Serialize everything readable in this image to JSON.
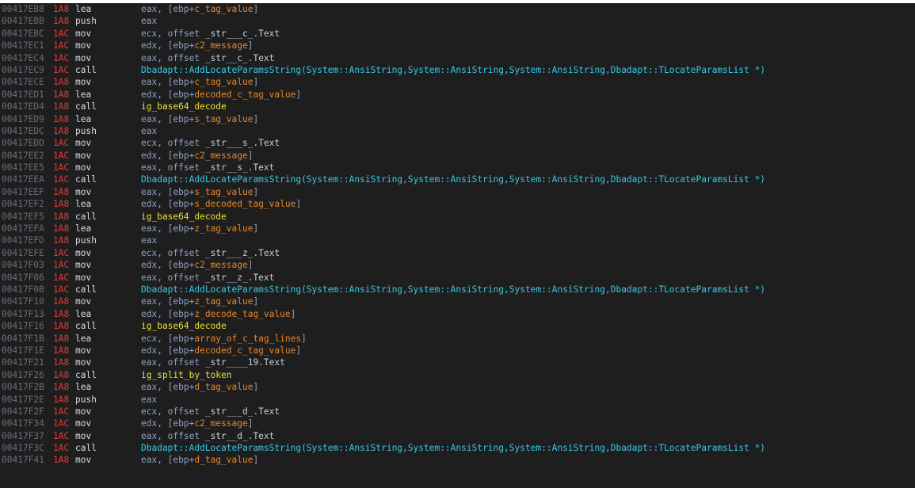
{
  "colors": {
    "background": "#1e1e1e",
    "address": "#666f7a",
    "stack_pointer": "#e23b3b",
    "mnemonic": "#d8dde6",
    "operand": "#8fa1c4",
    "symbol": "#e6862c",
    "api_call": "#38c7e8",
    "function": "#e5e134"
  },
  "lines": [
    {
      "addr": "00417EB8",
      "sp": "1A8",
      "mnem": "lea",
      "ops": [
        {
          "t": "eax, [ebp+",
          "k": "plain"
        },
        {
          "t": "c_tag_value",
          "k": "sym"
        },
        {
          "t": "]",
          "k": "plain"
        }
      ]
    },
    {
      "addr": "00417EBB",
      "sp": "1A8",
      "mnem": "push",
      "ops": [
        {
          "t": "eax",
          "k": "plain"
        }
      ]
    },
    {
      "addr": "00417EBC",
      "sp": "1AC",
      "mnem": "mov",
      "ops": [
        {
          "t": "ecx, offset ",
          "k": "plain"
        },
        {
          "t": "_str___c_.Text",
          "k": "str"
        }
      ]
    },
    {
      "addr": "00417EC1",
      "sp": "1AC",
      "mnem": "mov",
      "ops": [
        {
          "t": "edx, [ebp+",
          "k": "plain"
        },
        {
          "t": "c2_message",
          "k": "sym"
        },
        {
          "t": "]",
          "k": "plain"
        }
      ]
    },
    {
      "addr": "00417EC4",
      "sp": "1AC",
      "mnem": "mov",
      "ops": [
        {
          "t": "eax, offset ",
          "k": "plain"
        },
        {
          "t": "_str__c_.Text",
          "k": "str"
        }
      ]
    },
    {
      "addr": "00417EC9",
      "sp": "1AC",
      "mnem": "call",
      "ops": [
        {
          "t": "Dbadapt::AddLocateParamsString(System::AnsiString,System::AnsiString,System::AnsiString,Dbadapt::TLocateParamsList *)",
          "k": "api"
        }
      ]
    },
    {
      "addr": "00417ECE",
      "sp": "1A8",
      "mnem": "mov",
      "ops": [
        {
          "t": "eax, [ebp+",
          "k": "plain"
        },
        {
          "t": "c_tag_value",
          "k": "sym"
        },
        {
          "t": "]",
          "k": "plain"
        }
      ]
    },
    {
      "addr": "00417ED1",
      "sp": "1A8",
      "mnem": "lea",
      "ops": [
        {
          "t": "edx, [ebp+",
          "k": "plain"
        },
        {
          "t": "decoded_c_tag_value",
          "k": "sym"
        },
        {
          "t": "]",
          "k": "plain"
        }
      ]
    },
    {
      "addr": "00417ED4",
      "sp": "1A8",
      "mnem": "call",
      "ops": [
        {
          "t": "ig_base64_decode",
          "k": "func"
        }
      ]
    },
    {
      "addr": "00417ED9",
      "sp": "1A8",
      "mnem": "lea",
      "ops": [
        {
          "t": "eax, [ebp+",
          "k": "plain"
        },
        {
          "t": "s_tag_value",
          "k": "sym"
        },
        {
          "t": "]",
          "k": "plain"
        }
      ]
    },
    {
      "addr": "00417EDC",
      "sp": "1A8",
      "mnem": "push",
      "ops": [
        {
          "t": "eax",
          "k": "plain"
        }
      ]
    },
    {
      "addr": "00417EDD",
      "sp": "1AC",
      "mnem": "mov",
      "ops": [
        {
          "t": "ecx, offset ",
          "k": "plain"
        },
        {
          "t": "_str___s_.Text",
          "k": "str"
        }
      ]
    },
    {
      "addr": "00417EE2",
      "sp": "1AC",
      "mnem": "mov",
      "ops": [
        {
          "t": "edx, [ebp+",
          "k": "plain"
        },
        {
          "t": "c2_message",
          "k": "sym"
        },
        {
          "t": "]",
          "k": "plain"
        }
      ]
    },
    {
      "addr": "00417EE5",
      "sp": "1AC",
      "mnem": "mov",
      "ops": [
        {
          "t": "eax, offset ",
          "k": "plain"
        },
        {
          "t": "_str__s_.Text",
          "k": "str"
        }
      ]
    },
    {
      "addr": "00417EEA",
      "sp": "1AC",
      "mnem": "call",
      "ops": [
        {
          "t": "Dbadapt::AddLocateParamsString(System::AnsiString,System::AnsiString,System::AnsiString,Dbadapt::TLocateParamsList *)",
          "k": "api"
        }
      ]
    },
    {
      "addr": "00417EEF",
      "sp": "1A8",
      "mnem": "mov",
      "ops": [
        {
          "t": "eax, [ebp+",
          "k": "plain"
        },
        {
          "t": "s_tag_value",
          "k": "sym"
        },
        {
          "t": "]",
          "k": "plain"
        }
      ]
    },
    {
      "addr": "00417EF2",
      "sp": "1A8",
      "mnem": "lea",
      "ops": [
        {
          "t": "edx, [ebp+",
          "k": "plain"
        },
        {
          "t": "s_decoded_tag_value",
          "k": "sym"
        },
        {
          "t": "]",
          "k": "plain"
        }
      ]
    },
    {
      "addr": "00417EF5",
      "sp": "1A8",
      "mnem": "call",
      "ops": [
        {
          "t": "ig_base64_decode",
          "k": "func"
        }
      ]
    },
    {
      "addr": "00417EFA",
      "sp": "1A8",
      "mnem": "lea",
      "ops": [
        {
          "t": "eax, [ebp+",
          "k": "plain"
        },
        {
          "t": "z_tag_value",
          "k": "sym"
        },
        {
          "t": "]",
          "k": "plain"
        }
      ]
    },
    {
      "addr": "00417EFD",
      "sp": "1A8",
      "mnem": "push",
      "ops": [
        {
          "t": "eax",
          "k": "plain"
        }
      ]
    },
    {
      "addr": "00417EFE",
      "sp": "1AC",
      "mnem": "mov",
      "ops": [
        {
          "t": "ecx, offset ",
          "k": "plain"
        },
        {
          "t": "_str___z_.Text",
          "k": "str"
        }
      ]
    },
    {
      "addr": "00417F03",
      "sp": "1AC",
      "mnem": "mov",
      "ops": [
        {
          "t": "edx, [ebp+",
          "k": "plain"
        },
        {
          "t": "c2_message",
          "k": "sym"
        },
        {
          "t": "]",
          "k": "plain"
        }
      ]
    },
    {
      "addr": "00417F06",
      "sp": "1AC",
      "mnem": "mov",
      "ops": [
        {
          "t": "eax, offset ",
          "k": "plain"
        },
        {
          "t": "_str__z_.Text",
          "k": "str"
        }
      ]
    },
    {
      "addr": "00417F0B",
      "sp": "1AC",
      "mnem": "call",
      "ops": [
        {
          "t": "Dbadapt::AddLocateParamsString(System::AnsiString,System::AnsiString,System::AnsiString,Dbadapt::TLocateParamsList *)",
          "k": "api"
        }
      ]
    },
    {
      "addr": "00417F10",
      "sp": "1A8",
      "mnem": "mov",
      "ops": [
        {
          "t": "eax, [ebp+",
          "k": "plain"
        },
        {
          "t": "z_tag_value",
          "k": "sym"
        },
        {
          "t": "]",
          "k": "plain"
        }
      ]
    },
    {
      "addr": "00417F13",
      "sp": "1A8",
      "mnem": "lea",
      "ops": [
        {
          "t": "edx, [ebp+",
          "k": "plain"
        },
        {
          "t": "z_decode_tag_value",
          "k": "sym"
        },
        {
          "t": "]",
          "k": "plain"
        }
      ]
    },
    {
      "addr": "00417F16",
      "sp": "1A8",
      "mnem": "call",
      "ops": [
        {
          "t": "ig_base64_decode",
          "k": "func"
        }
      ]
    },
    {
      "addr": "00417F1B",
      "sp": "1A8",
      "mnem": "lea",
      "ops": [
        {
          "t": "ecx, [ebp+",
          "k": "plain"
        },
        {
          "t": "array_of_c_tag_lines",
          "k": "sym"
        },
        {
          "t": "]",
          "k": "plain"
        }
      ]
    },
    {
      "addr": "00417F1E",
      "sp": "1A8",
      "mnem": "mov",
      "ops": [
        {
          "t": "edx, [ebp+",
          "k": "plain"
        },
        {
          "t": "decoded_c_tag_value",
          "k": "sym"
        },
        {
          "t": "]",
          "k": "plain"
        }
      ]
    },
    {
      "addr": "00417F21",
      "sp": "1A8",
      "mnem": "mov",
      "ops": [
        {
          "t": "eax, offset ",
          "k": "plain"
        },
        {
          "t": "_str____19.Text",
          "k": "str"
        }
      ]
    },
    {
      "addr": "00417F26",
      "sp": "1A8",
      "mnem": "call",
      "ops": [
        {
          "t": "ig_split_by_token",
          "k": "func"
        }
      ]
    },
    {
      "addr": "00417F2B",
      "sp": "1A8",
      "mnem": "lea",
      "ops": [
        {
          "t": "eax, [ebp+",
          "k": "plain"
        },
        {
          "t": "d_tag_value",
          "k": "sym"
        },
        {
          "t": "]",
          "k": "plain"
        }
      ]
    },
    {
      "addr": "00417F2E",
      "sp": "1A8",
      "mnem": "push",
      "ops": [
        {
          "t": "eax",
          "k": "plain"
        }
      ]
    },
    {
      "addr": "00417F2F",
      "sp": "1AC",
      "mnem": "mov",
      "ops": [
        {
          "t": "ecx, offset ",
          "k": "plain"
        },
        {
          "t": "_str___d_.Text",
          "k": "str"
        }
      ]
    },
    {
      "addr": "00417F34",
      "sp": "1AC",
      "mnem": "mov",
      "ops": [
        {
          "t": "edx, [ebp+",
          "k": "plain"
        },
        {
          "t": "c2_message",
          "k": "sym"
        },
        {
          "t": "]",
          "k": "plain"
        }
      ]
    },
    {
      "addr": "00417F37",
      "sp": "1AC",
      "mnem": "mov",
      "ops": [
        {
          "t": "eax, offset ",
          "k": "plain"
        },
        {
          "t": "_str__d_.Text",
          "k": "str"
        }
      ]
    },
    {
      "addr": "00417F3C",
      "sp": "1AC",
      "mnem": "call",
      "ops": [
        {
          "t": "Dbadapt::AddLocateParamsString(System::AnsiString,System::AnsiString,System::AnsiString,Dbadapt::TLocateParamsList *)",
          "k": "api"
        }
      ]
    },
    {
      "addr": "00417F41",
      "sp": "1A8",
      "mnem": "mov",
      "ops": [
        {
          "t": "eax, [ebp+",
          "k": "plain"
        },
        {
          "t": "d_tag_value",
          "k": "sym"
        },
        {
          "t": "]",
          "k": "plain"
        }
      ]
    }
  ]
}
